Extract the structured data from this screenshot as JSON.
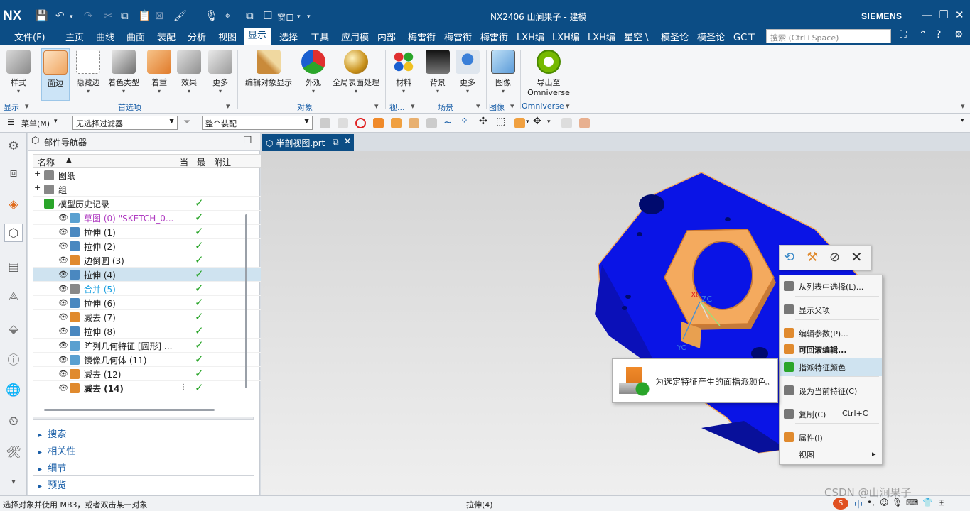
{
  "app": {
    "logo": "NX",
    "title": "NX2406 山涧果子 - 建模",
    "brand": "SIEMENS",
    "window_menu": "窗口"
  },
  "menu": {
    "file": "文件(F)",
    "tabs": [
      "主页",
      "曲线",
      "曲面",
      "装配",
      "分析",
      "视图",
      "显示",
      "选择",
      "工具",
      "应用模",
      "内部",
      "梅雷衔",
      "梅雷衔",
      "梅雷衔",
      "LXH编",
      "LXH编",
      "LXH编",
      "星空 \\",
      "模圣论",
      "模圣论",
      "GC工"
    ],
    "active_tab": "显示",
    "search_placeholder": "搜索 (Ctrl+Space)"
  },
  "ribbon": {
    "buttons": [
      {
        "label": "样式",
        "icon": "style-cube-icon"
      },
      {
        "label": "面边",
        "icon": "face-edge-cube-icon"
      },
      {
        "label": "隐藏边",
        "icon": "hidden-edge-cube-icon"
      },
      {
        "label": "着色类型",
        "icon": "shading-type-cube-icon"
      },
      {
        "label": "着重",
        "icon": "emphasis-cube-icon"
      },
      {
        "label": "效果",
        "icon": "effects-cube-icon"
      },
      {
        "label": "更多",
        "icon": "more-cube-icon"
      },
      {
        "label": "编辑对象显示",
        "icon": "brush-icon"
      },
      {
        "label": "外观",
        "icon": "appearance-pie-icon"
      },
      {
        "label": "全局表面处理",
        "icon": "gold-sphere-icon"
      },
      {
        "label": "材料",
        "icon": "material-spheres-icon"
      },
      {
        "label": "背景",
        "icon": "background-icon"
      },
      {
        "label": "更多",
        "icon": "scene-more-icon"
      },
      {
        "label": "图像",
        "icon": "image-icon"
      },
      {
        "label": "导出至",
        "label2": "Omniverse",
        "icon": "omniverse-ring-icon"
      }
    ],
    "groups": [
      "显示",
      "首选项",
      "对象",
      "视...",
      "场景",
      "图像",
      "Omniverse"
    ]
  },
  "selection_bar": {
    "menu": "菜单(M)",
    "filter": "无选择过滤器",
    "scope": "整个装配"
  },
  "navigator": {
    "title": "部件导航器",
    "columns": {
      "name": "名称",
      "current": "当",
      "latest": "最",
      "comment": "附注"
    },
    "rows": [
      {
        "label": "图纸",
        "indent": 0,
        "toggle": "+",
        "check": "",
        "color": "#222",
        "bold": false,
        "icon": "drawing-icon",
        "icon_color": "#888"
      },
      {
        "label": "组",
        "indent": 0,
        "toggle": "+",
        "check": "",
        "color": "#222",
        "bold": false,
        "icon": "group-icon",
        "icon_color": "#888"
      },
      {
        "label": "模型历史记录",
        "indent": 0,
        "toggle": "−",
        "check": "✓",
        "color": "#222",
        "bold": false,
        "icon": "model-history-icon",
        "icon_color": "#2aa52a"
      },
      {
        "label": "草图 (0) \"SKETCH_0...",
        "indent": 1,
        "toggle": "",
        "check": "✓",
        "color": "#b03cc2",
        "bold": false,
        "icon": "sketch-icon",
        "icon_color": "#5aa0d0"
      },
      {
        "label": "拉伸 (1)",
        "indent": 1,
        "toggle": "",
        "check": "✓",
        "color": "#222",
        "bold": false,
        "icon": "extrude-icon",
        "icon_color": "#4a88c0"
      },
      {
        "label": "拉伸 (2)",
        "indent": 1,
        "toggle": "",
        "check": "✓",
        "color": "#222",
        "bold": false,
        "icon": "extrude-icon",
        "icon_color": "#4a88c0"
      },
      {
        "label": "边倒圆 (3)",
        "indent": 1,
        "toggle": "",
        "check": "✓",
        "color": "#222",
        "bold": false,
        "icon": "edge-blend-icon",
        "icon_color": "#e08a2e"
      },
      {
        "label": "拉伸 (4)",
        "indent": 1,
        "toggle": "",
        "check": "✓",
        "color": "#222",
        "bold": false,
        "icon": "extrude-icon",
        "icon_color": "#4a88c0",
        "selected": true
      },
      {
        "label": "合并 (5)",
        "indent": 1,
        "toggle": "",
        "check": "✓",
        "color": "#1aa0e0",
        "bold": false,
        "icon": "unite-icon",
        "icon_color": "#888"
      },
      {
        "label": "拉伸 (6)",
        "indent": 1,
        "toggle": "",
        "check": "✓",
        "color": "#222",
        "bold": false,
        "icon": "extrude-icon",
        "icon_color": "#4a88c0"
      },
      {
        "label": "减去 (7)",
        "indent": 1,
        "toggle": "",
        "check": "✓",
        "color": "#222",
        "bold": false,
        "icon": "subtract-icon",
        "icon_color": "#e08a2e"
      },
      {
        "label": "拉伸 (8)",
        "indent": 1,
        "toggle": "",
        "check": "✓",
        "color": "#222",
        "bold": false,
        "icon": "extrude-icon",
        "icon_color": "#4a88c0"
      },
      {
        "label": "阵列几何特征 [圆形] ...",
        "indent": 1,
        "toggle": "",
        "check": "✓",
        "color": "#222",
        "bold": false,
        "icon": "pattern-icon",
        "icon_color": "#5aa0d0"
      },
      {
        "label": "镜像几何体 (11)",
        "indent": 1,
        "toggle": "",
        "check": "✓",
        "color": "#222",
        "bold": false,
        "icon": "mirror-icon",
        "icon_color": "#5aa0d0"
      },
      {
        "label": "减去 (12)",
        "indent": 1,
        "toggle": "",
        "check": "✓",
        "color": "#222",
        "bold": false,
        "icon": "subtract-icon",
        "icon_color": "#e08a2e"
      },
      {
        "label": "减去 (14)",
        "indent": 1,
        "toggle": "",
        "check": "✓",
        "color": "#222",
        "bold": true,
        "icon": "subtract-icon",
        "icon_color": "#e08a2e",
        "current_marker": true
      }
    ],
    "sections": [
      "搜索",
      "相关性",
      "细节",
      "预览"
    ]
  },
  "viewport": {
    "tab_label": "半剖视图.prt",
    "axis_labels": [
      "XC",
      "ZC",
      "YC"
    ]
  },
  "context_menu": {
    "items": [
      {
        "label": "从列表中选择(L)...",
        "shortcut": "",
        "submenu": false,
        "highlight": false,
        "icon": "list-select-icon",
        "icon_color": "#777"
      },
      {
        "label": "显示父项",
        "shortcut": "",
        "submenu": false,
        "highlight": false,
        "icon": "show-parents-icon",
        "icon_color": "#777"
      },
      {
        "label": "编辑参数(P)...",
        "shortcut": "",
        "submenu": false,
        "highlight": false,
        "icon": "edit-params-icon",
        "icon_color": "#e08a2e"
      },
      {
        "label": "可回滚编辑...",
        "shortcut": "",
        "submenu": false,
        "highlight": false,
        "bold": true,
        "icon": "rollback-edit-icon",
        "icon_color": "#e08a2e"
      },
      {
        "label": "指派特征颜色",
        "shortcut": "",
        "submenu": false,
        "highlight": true,
        "icon": "assign-color-icon",
        "icon_color": "#2aa52a"
      },
      {
        "label": "设为当前特征(C)",
        "shortcut": "",
        "submenu": false,
        "highlight": false,
        "icon": "make-current-icon",
        "icon_color": "#777"
      },
      {
        "label": "复制(C)",
        "shortcut": "Ctrl+C",
        "submenu": false,
        "highlight": false,
        "icon": "copy-icon",
        "icon_color": "#777"
      },
      {
        "label": "属性(I)",
        "shortcut": "",
        "submenu": false,
        "highlight": false,
        "icon": "properties-icon",
        "icon_color": "#e08a2e"
      },
      {
        "label": "视图",
        "shortcut": "",
        "submenu": true,
        "highlight": false,
        "icon": "",
        "icon_color": ""
      }
    ]
  },
  "tooltip": {
    "text": "为选定特征产生的面指派颜色。"
  },
  "status": {
    "left": "选择对象并使用 MB3，或者双击某一对象",
    "center": "拉伸(4)",
    "watermark": "CSDN @山涧果子",
    "ime": "中"
  },
  "colors": {
    "title_bar": "#0c4d85",
    "model_blue": "#0a14e6",
    "highlight_orange": "#f4aa5e",
    "check_green": "#2aa52a"
  }
}
